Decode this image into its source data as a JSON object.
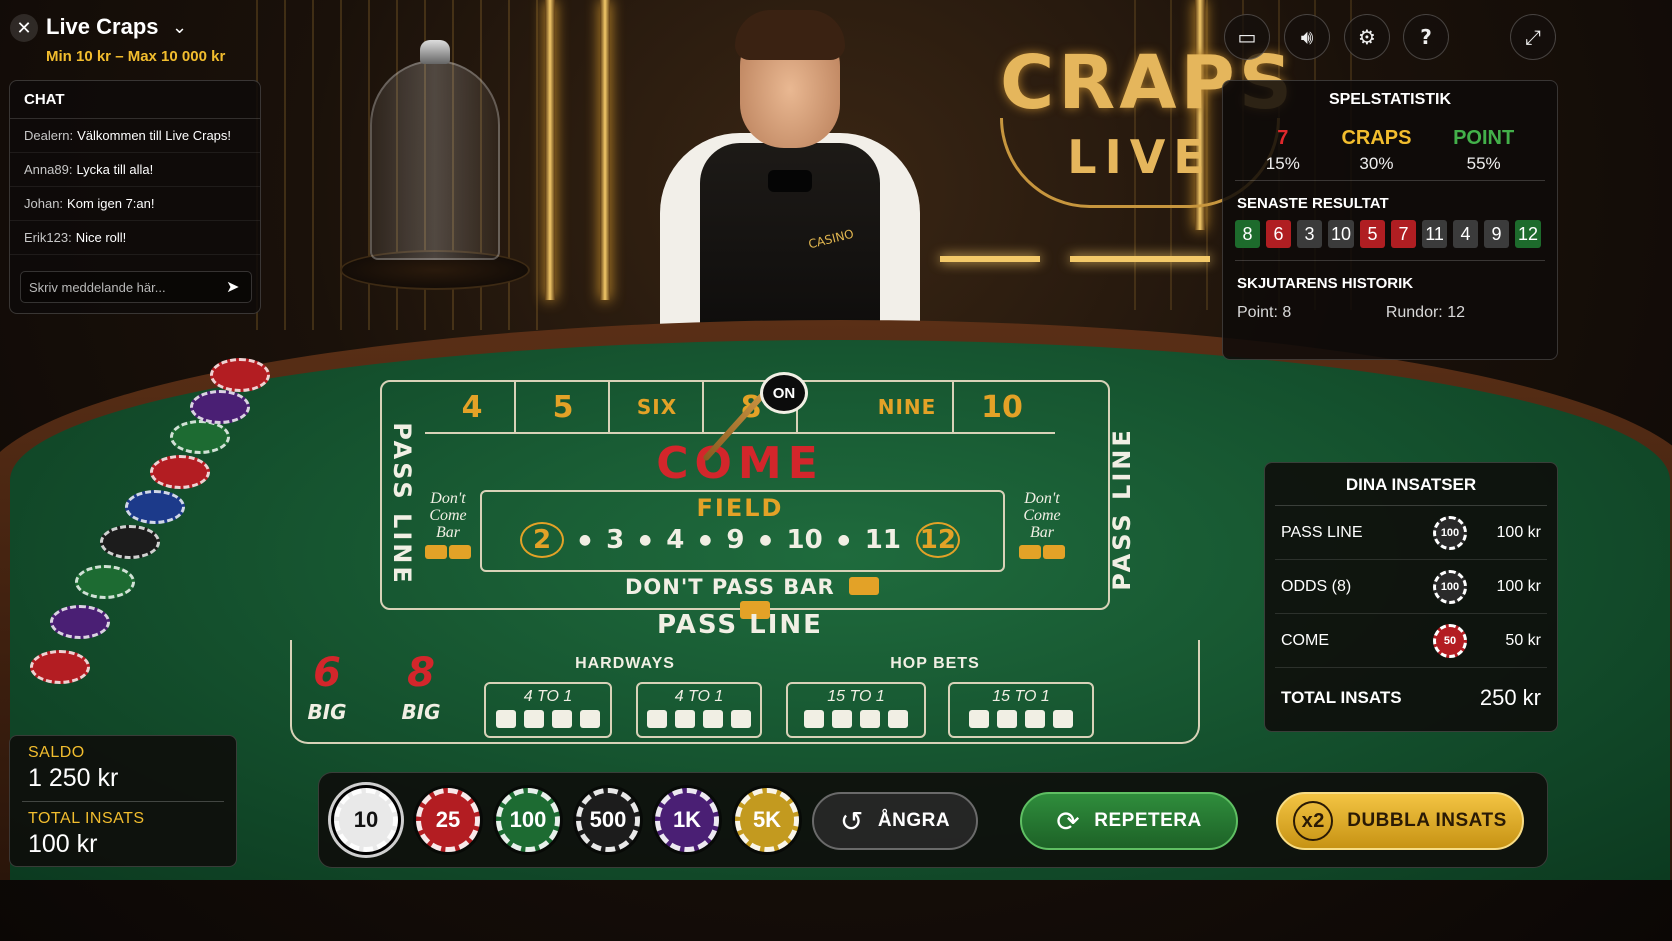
{
  "header": {
    "title": "Live Craps",
    "limits": "Min 10 kr – Max 10 000 kr"
  },
  "chat": {
    "title": "CHAT",
    "messages": [
      {
        "user": "Dealern:",
        "text": "Välkommen till Live Craps!"
      },
      {
        "user": "Anna89:",
        "text": "Lycka till alla!"
      },
      {
        "user": "Johan:",
        "text": "Kom igen 7:an!"
      },
      {
        "user": "Erik123:",
        "text": "Nice roll!"
      }
    ],
    "placeholder": "Skriv meddelande här..."
  },
  "toolbar": {
    "icons": [
      "picture-in-picture-icon",
      "volume-icon",
      "settings-icon",
      "help-icon",
      "fullscreen-icon"
    ]
  },
  "scene": {
    "logo_line1": "CRAPS",
    "logo_line2": "LIVE",
    "dealer_badge": "CASINO"
  },
  "stats": {
    "title": "SPELSTATISTIK",
    "seven": {
      "label": "7",
      "pct": "15%"
    },
    "craps": {
      "label": "CRAPS",
      "pct": "30%"
    },
    "point": {
      "label": "POINT",
      "pct": "55%"
    },
    "recent_title": "SENASTE RESULTAT",
    "recent": [
      {
        "v": "8",
        "c": "g"
      },
      {
        "v": "6",
        "c": "r"
      },
      {
        "v": "3",
        "c": "k"
      },
      {
        "v": "10",
        "c": "k"
      },
      {
        "v": "5",
        "c": "r"
      },
      {
        "v": "7",
        "c": "r"
      },
      {
        "v": "11",
        "c": "k"
      },
      {
        "v": "4",
        "c": "k"
      },
      {
        "v": "9",
        "c": "k"
      },
      {
        "v": "12",
        "c": "g"
      }
    ],
    "shooter_title": "SKJUTARENS HISTORIK",
    "point_label": "Point:",
    "point_value": "8",
    "rounds_label": "Rundor:",
    "rounds_value": "12"
  },
  "table": {
    "place_numbers": [
      "4",
      "5",
      "SIX",
      "8",
      "NINE",
      "10"
    ],
    "puck": "ON",
    "come": "COME",
    "field": "FIELD",
    "field_numbers": [
      "2",
      "3",
      "4",
      "9",
      "10",
      "11",
      "12"
    ],
    "dont_come_bar": [
      "Don't",
      "Come",
      "Bar"
    ],
    "pass_line": "PASS LINE",
    "dont_pass_bar": "DON'T PASS BAR",
    "big6": {
      "n": "6",
      "t": "BIG"
    },
    "big8": {
      "n": "8",
      "t": "BIG"
    },
    "hardways": "HARDWAYS",
    "hop_bets": "HOP BETS",
    "hardway_odds": [
      "4 TO 1",
      "4 TO 1"
    ],
    "hop_odds": [
      "15 TO 1",
      "15 TO 1"
    ]
  },
  "bets": {
    "title": "DINA INSATSER",
    "rows": [
      {
        "name": "PASS LINE",
        "chip": "100",
        "amount": "100 kr"
      },
      {
        "name": "ODDS (8)",
        "chip": "100",
        "amount": "100 kr"
      },
      {
        "name": "COME",
        "chip": "50",
        "amount": "50 kr"
      }
    ],
    "total_label": "TOTAL INSATS",
    "total_value": "250 kr"
  },
  "balance": {
    "saldo_label": "SALDO",
    "saldo_value": "1 250 kr",
    "total_label": "TOTAL INSATS",
    "total_value": "100 kr"
  },
  "chips": [
    {
      "label": "10",
      "color": "#e9e9e9",
      "text": "#111111",
      "selected": true
    },
    {
      "label": "25",
      "color": "#b31d22"
    },
    {
      "label": "100",
      "color": "#1d6b32"
    },
    {
      "label": "500",
      "color": "#1c1c1c"
    },
    {
      "label": "1K",
      "color": "#4a1f74"
    },
    {
      "label": "5K",
      "color": "#c39a1f"
    }
  ],
  "actions": {
    "undo": "ÅNGRA",
    "repeat": "REPETERA",
    "double_badge": "x2",
    "double": "DUBBLA INSATS"
  }
}
